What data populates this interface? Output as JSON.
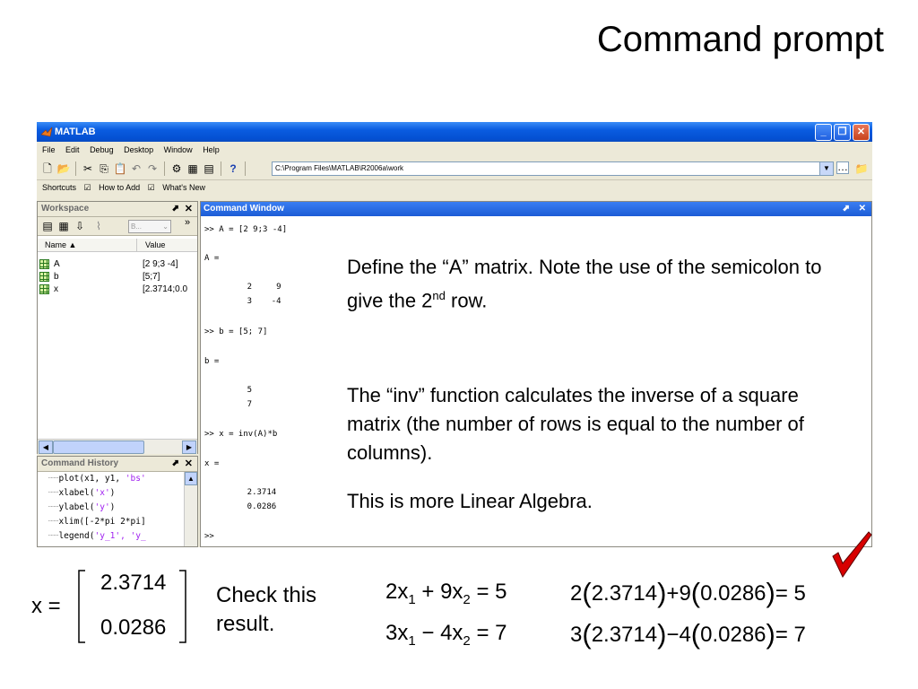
{
  "slide": {
    "title": "Command prompt"
  },
  "window": {
    "title": "MATLAB",
    "menu": [
      "File",
      "Edit",
      "Debug",
      "Desktop",
      "Window",
      "Help"
    ],
    "current_dir": "C:\\Program Files\\MATLAB\\R2006a\\work",
    "shortcuts": [
      "Shortcuts",
      "How to Add",
      "What's New"
    ]
  },
  "workspace": {
    "title": "Workspace",
    "filter_label": "B...",
    "col_name": "Name ▲",
    "col_value": "Value",
    "vars": [
      {
        "name": "A",
        "value": "[2 9;3 -4]"
      },
      {
        "name": "b",
        "value": "[5;7]"
      },
      {
        "name": "x",
        "value": "[2.3714;0.0"
      }
    ]
  },
  "history": {
    "title": "Command History",
    "items": [
      {
        "code": "plot(x1, y1, ",
        "str": "'bs'"
      },
      {
        "code": "xlabel(",
        "str": "'x'",
        "tail": ")"
      },
      {
        "code": "ylabel(",
        "str": "'y'",
        "tail": ")"
      },
      {
        "code": "xlim([-2*pi 2*pi]",
        "str": ""
      },
      {
        "code": "legend(",
        "str": "'y_1', 'y_",
        "tail": ""
      }
    ]
  },
  "command_window": {
    "title": "Command Window",
    "lines": [
      ">> A = [2 9;3 -4]",
      "A =",
      "    2     9",
      "    3    -4",
      ">> b = [5; 7]",
      "b =",
      "    5",
      "    7",
      ">> x = inv(A)*b",
      "x =",
      "    2.3714",
      "    0.0286",
      ">>"
    ]
  },
  "notes": {
    "define_a": "Define the “A” matrix. Note the use of the semicolon to give the 2",
    "define_a_sup": "nd",
    "define_a_tail": " row.",
    "inv": "The “inv” function calculates the inverse of a square matrix (the number of rows is equal to the number of columns).",
    "linalg": "This is more Linear Algebra.",
    "check": "Check this result."
  },
  "result": {
    "var": "x",
    "values": [
      "2.3714",
      "0.0286"
    ]
  },
  "equations": {
    "eq1": {
      "coef1": "2x",
      "sub1": "1",
      "op": "+",
      "coef2": "9x",
      "sub2": "2",
      "rhs": "= 5"
    },
    "eq2": {
      "coef1": "3x",
      "sub1": "1",
      "op": "−",
      "coef2": "4x",
      "sub2": "2",
      "rhs": "= 7"
    },
    "sub1": {
      "a": "2",
      "x1": "2.3714",
      "op": "+",
      "b": "9",
      "x2": "0.0286",
      "rhs": "= 5"
    },
    "sub2": {
      "a": "3",
      "x1": "2.3714",
      "op": "−",
      "b": "4",
      "x2": "0.0286",
      "rhs": "= 7"
    }
  },
  "colors": {
    "checkmark": "#d80000",
    "string": "#a020f0",
    "titlebar": "#0a5ce0"
  }
}
